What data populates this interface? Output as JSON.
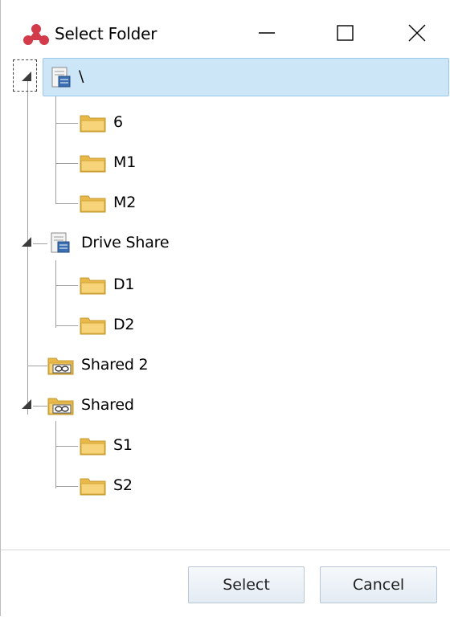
{
  "window": {
    "title": "Select Folder",
    "accent_color": "#d33a4a"
  },
  "tree": {
    "nodes": [
      {
        "label": "\\",
        "icon": "server-share-icon",
        "selected": true,
        "expanded": true
      },
      {
        "label": "6",
        "icon": "folder-icon"
      },
      {
        "label": "M1",
        "icon": "folder-icon"
      },
      {
        "label": "M2",
        "icon": "folder-icon"
      },
      {
        "label": "Drive Share",
        "icon": "server-share-icon",
        "expanded": true
      },
      {
        "label": "D1",
        "icon": "folder-icon"
      },
      {
        "label": "D2",
        "icon": "folder-icon"
      },
      {
        "label": "Shared 2",
        "icon": "linked-folder-icon"
      },
      {
        "label": "Shared",
        "icon": "linked-folder-icon",
        "expanded": true
      },
      {
        "label": "S1",
        "icon": "folder-icon"
      },
      {
        "label": "S2",
        "icon": "folder-icon"
      }
    ]
  },
  "footer": {
    "select_label": "Select",
    "cancel_label": "Cancel"
  }
}
